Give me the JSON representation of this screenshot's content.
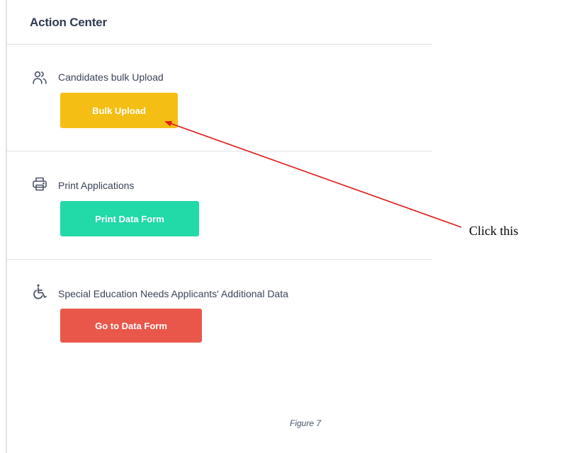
{
  "panel": {
    "title": "Action Center"
  },
  "sections": [
    {
      "icon": "users-icon",
      "label": "Candidates bulk Upload",
      "button_label": "Bulk Upload",
      "button_color": "#f4be14"
    },
    {
      "icon": "printer-icon",
      "label": "Print Applications",
      "button_label": "Print Data Form",
      "button_color": "#22d9a8"
    },
    {
      "icon": "wheelchair-icon",
      "label": "Special Education Needs Applicants' Additional Data",
      "button_label": "Go to Data Form",
      "button_color": "#e9574b"
    }
  ],
  "annotation": {
    "text": "Click this",
    "arrow_color": "#e01b1b"
  },
  "caption": "Figure 7"
}
